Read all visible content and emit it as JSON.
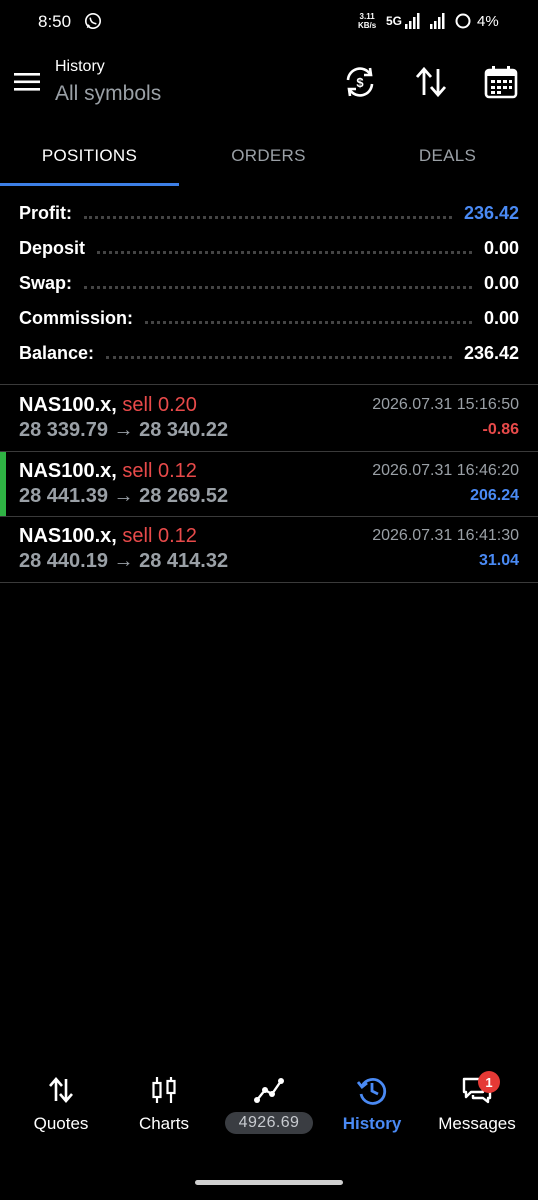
{
  "status_bar": {
    "time": "8:50",
    "net_speed_value": "3.11",
    "net_speed_unit": "KB/s",
    "network": "5G",
    "battery": "4%"
  },
  "app_bar": {
    "title": "History",
    "subtitle": "All symbols",
    "icons": [
      "menu-icon",
      "sync-icon",
      "sort-icon",
      "calendar-icon"
    ]
  },
  "tabs": [
    {
      "label": "POSITIONS",
      "active": true
    },
    {
      "label": "ORDERS",
      "active": false
    },
    {
      "label": "DEALS",
      "active": false
    }
  ],
  "summary": {
    "profit": {
      "label": "Profit:",
      "value": "236.42"
    },
    "deposit": {
      "label": "Deposit",
      "value": "0.00"
    },
    "swap": {
      "label": "Swap:",
      "value": "0.00"
    },
    "commission": {
      "label": "Commission:",
      "value": "0.00"
    },
    "balance": {
      "label": "Balance:",
      "value": "236.42"
    }
  },
  "deals": [
    {
      "symbol": "NAS100.x,",
      "side": "sell 0.20",
      "prices": "28 339.79 → 28 340.22",
      "time": "2026.07.31 15:16:50",
      "profit": "-0.86",
      "profit_sign": "negative",
      "highlighted": false
    },
    {
      "symbol": "NAS100.x,",
      "side": "sell 0.12",
      "prices": "28 441.39 → 28 269.52",
      "time": "2026.07.31 16:46:20",
      "profit": "206.24",
      "profit_sign": "positive",
      "highlighted": true
    },
    {
      "symbol": "NAS100.x,",
      "side": "sell 0.12",
      "prices": "28 440.19 → 28 414.32",
      "time": "2026.07.31 16:41:30",
      "profit": "31.04",
      "profit_sign": "positive",
      "highlighted": false
    }
  ],
  "bottom_nav": {
    "items": [
      {
        "label": "Quotes",
        "icon": "quotes-arrows-icon",
        "active": false
      },
      {
        "label": "Charts",
        "icon": "candlestick-icon",
        "active": false
      },
      {
        "label": "4926.69",
        "icon": "trade-line-icon",
        "active": false
      },
      {
        "label": "History",
        "icon": "history-clock-icon",
        "active": true
      },
      {
        "label": "Messages",
        "icon": "messages-icon",
        "active": false
      }
    ],
    "messages_badge": "1"
  },
  "colors": {
    "accent_blue": "#4a8af4",
    "sell_red": "#e84a4a",
    "highlight_green": "#2fb344",
    "background": "#000000"
  }
}
